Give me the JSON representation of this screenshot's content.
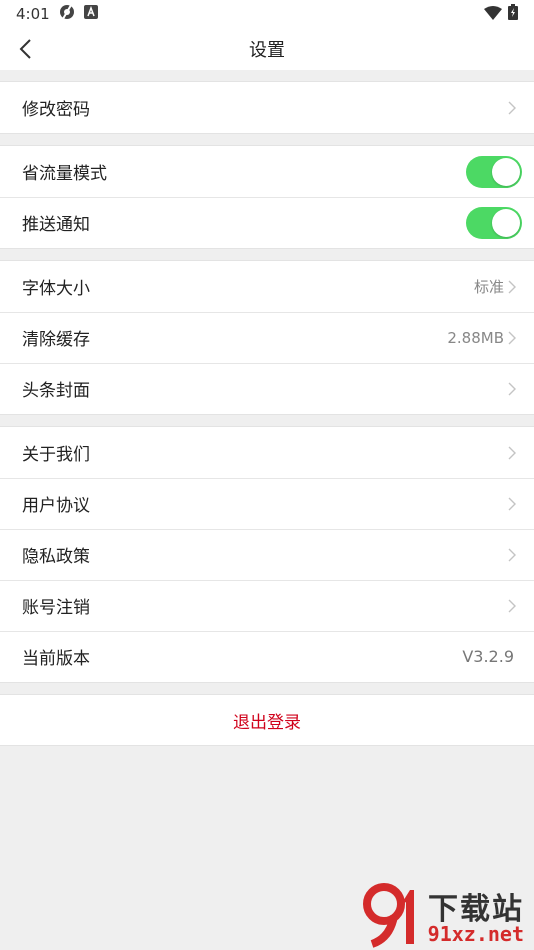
{
  "status_bar": {
    "time": "4:01"
  },
  "header": {
    "title": "设置"
  },
  "groups": {
    "account": {
      "change_password": "修改密码"
    },
    "toggles": {
      "data_saver": "省流量模式",
      "push": "推送通知"
    },
    "display": {
      "font_size": "字体大小",
      "font_size_value": "标准",
      "clear_cache": "清除缓存",
      "clear_cache_value": "2.88MB",
      "headline_cover": "头条封面"
    },
    "about": {
      "about_us": "关于我们",
      "user_agreement": "用户协议",
      "privacy_policy": "隐私政策",
      "account_cancel": "账号注销",
      "current_version": "当前版本",
      "version_value": "V3.2.9"
    }
  },
  "logout": {
    "label": "退出登录"
  },
  "watermark": {
    "top": "下载站",
    "bottom": "91xz.net"
  },
  "colors": {
    "toggle_on": "#4cd964",
    "logout": "#d0021b",
    "background": "#efefef"
  }
}
